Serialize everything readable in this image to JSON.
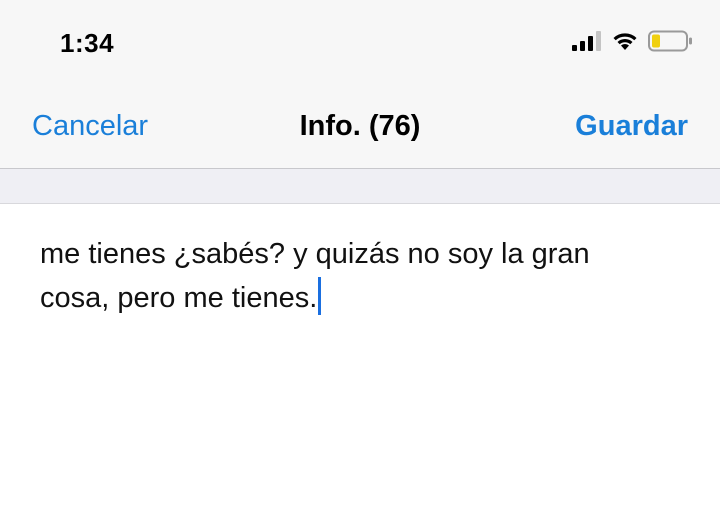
{
  "status_bar": {
    "time": "1:34",
    "icons": [
      "cellular-signal-icon",
      "wifi-icon",
      "battery-low-icon"
    ],
    "battery_color": "#f0d010"
  },
  "nav": {
    "cancel_label": "Cancelar",
    "title": "Info. (76)",
    "save_label": "Guardar"
  },
  "editor": {
    "line1": "me tienes ¿sabés? y quizás no soy la gran",
    "line2": "cosa, pero me tienes."
  },
  "colors": {
    "accent": "#1a7fd9",
    "caret": "#1a6fe0",
    "bar_background": "#f7f7f7",
    "band_background": "#efeff4"
  }
}
